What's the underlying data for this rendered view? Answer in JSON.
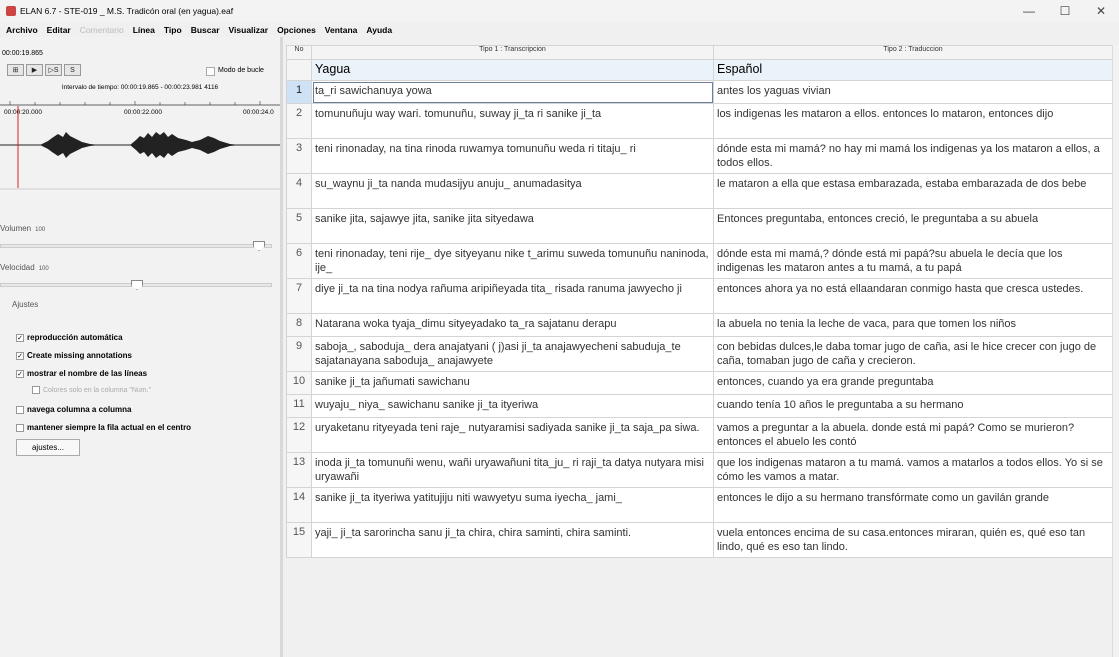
{
  "window": {
    "title": "ELAN 6.7 - STE-019 _ M.S. Tradicón oral (en yagua).eaf",
    "controls": {
      "minimize": "—",
      "maximize": "☐",
      "close": "✕"
    }
  },
  "menu": {
    "items": [
      {
        "label": "Archivo",
        "enabled": true
      },
      {
        "label": "Editar",
        "enabled": true
      },
      {
        "label": "Comentario",
        "enabled": false
      },
      {
        "label": "Línea",
        "enabled": true
      },
      {
        "label": "Tipo",
        "enabled": true
      },
      {
        "label": "Buscar",
        "enabled": true
      },
      {
        "label": "Visualizar",
        "enabled": true
      },
      {
        "label": "Opciones",
        "enabled": true
      },
      {
        "label": "Ventana",
        "enabled": true
      },
      {
        "label": "Ayuda",
        "enabled": true
      }
    ]
  },
  "player": {
    "timecode": "00:00:19.865",
    "buttons": [
      "⊞",
      "▶",
      "▷S",
      "S"
    ],
    "loop_label": "Modo de bucle",
    "interval_label": "Intervalo de tiempo: 00:00:19.865 - 00:00:23.981  4116",
    "ticks": [
      "00:00:20.000",
      "00:00:22.000",
      "00:00:24.0"
    ]
  },
  "volume": {
    "label": "Volumen",
    "value": "100",
    "level": 0.97
  },
  "speed": {
    "label": "Velocidad",
    "value": "100",
    "level": 0.5
  },
  "settings": {
    "title": "Ajustes",
    "options": [
      {
        "label": "reproducción automática",
        "checked": true,
        "bold": true
      },
      {
        "label": "Create missing annotations",
        "checked": true,
        "bold": true
      },
      {
        "label": "mostrar el nombre de las líneas",
        "checked": true,
        "bold": true
      },
      {
        "label": "Colores solo en la columna \"Num.\"",
        "checked": false,
        "bold": false,
        "disabled": true
      },
      {
        "label": "navega columna a columna",
        "checked": false,
        "bold": true
      },
      {
        "label": "mantener siempre la fila actual en el centro",
        "checked": false,
        "bold": true
      }
    ],
    "button_label": "ajustes..."
  },
  "grid": {
    "headers": {
      "num": "No",
      "col1": "Tipo 1 : Transcripcion",
      "col2": "Tipo 2 : Traduccion"
    },
    "language_row": {
      "col1": "Yagua",
      "col2": "Español"
    },
    "rows": [
      {
        "n": "1",
        "yagua": "ta_ri sawichanuya yowa",
        "espanol": "antes los yaguas vivian"
      },
      {
        "n": "2",
        "yagua": "tomunuñuju way wari. tomunuñu, suway ji_ta ri sanike ji_ta",
        "espanol": "los indigenas les mataron a ellos. entonces lo mataron, entonces dijo"
      },
      {
        "n": "3",
        "yagua": "teni rinonaday, na tina rinoda ruwamya tomunuñu weda ri titaju_ ri",
        "espanol": "dónde esta mi mamá? no hay mi mamá los indigenas ya los mataron a ellos, a todos ellos."
      },
      {
        "n": "4",
        "yagua": "su_waynu ji_ta nanda mudasijyu anuju_ anumadasitya",
        "espanol": "le mataron a ella que estasa embarazada, estaba embarazada de dos bebe"
      },
      {
        "n": "5",
        "yagua": "sanike jita, sajawye jita, sanike jita sityedawa",
        "espanol": "Entonces preguntaba, entonces creció, le preguntaba a su abuela"
      },
      {
        "n": "6",
        "yagua": "teni rinonaday, teni rije_ dye sityeyanu nike t_arimu suweda tomunuñu naninoda, ije_",
        "espanol": "dónde esta mi mamá,? dónde está mi papá?su abuela le decía que los indigenas les mataron antes a tu mamá, a tu papá"
      },
      {
        "n": "7",
        "yagua": "diye ji_ta na tina nodya rañuma aripiñeyada tita_ risada ranuma jawyecho ji",
        "espanol": "entonces ahora ya no está ellaandaran conmigo hasta que cresca ustedes."
      },
      {
        "n": "8",
        "yagua": "Natarana woka tyaja_dimu sityeyadako ta_ra sajatanu derapu",
        "espanol": "la abuela no tenia la leche de vaca, para que tomen los niños"
      },
      {
        "n": "9",
        "yagua": "saboja_, saboduja_ dera anajatyani ( j)asi ji_ta anajawyecheni sabuduja_te sajatanayana saboduja_ anajawyete",
        "espanol": "con bebidas dulces,le daba tomar  jugo de caña, asi le hice crecer con jugo de caña, tomaban jugo de caña y crecieron."
      },
      {
        "n": "10",
        "yagua": "sanike ji_ta jañumati sawichanu",
        "espanol": "entonces, cuando ya era grande preguntaba"
      },
      {
        "n": "11",
        "yagua": "wuyaju_ niya_ sawichanu sanike ji_ta ityeriwa",
        "espanol": "cuando tenía 10 años le preguntaba a su hermano"
      },
      {
        "n": "12",
        "yagua": "uryaketanu rityeyada teni raje_ nutyaramisi sadiyada sanike ji_ta saja_pa siwa.",
        "espanol": "vamos a preguntar a la abuela. donde está mi papá? Como se murieron? entonces el abuelo les contó"
      },
      {
        "n": "13",
        "yagua": "inoda ji_ta tomunuñi wenu, wañi uryawañuni tita_ju_ ri raji_ta datya nutyara misi uryawañi",
        "espanol": "que los indigenas mataron a tu mamá. vamos a matarlos a todos ellos. Yo si se cómo les vamos a matar."
      },
      {
        "n": "14",
        "yagua": "sanike ji_ta ityeriwa yatitujiju niti wawyetyu suma iyecha_ jami_",
        "espanol": "entonces le dijo a su hermano transfórmate como un gavilán grande"
      },
      {
        "n": "15",
        "yagua": "yaji_ ji_ta sarorincha sanu ji_ta chira, chira saminti, chira saminti.",
        "espanol": "vuela entonces encima de su casa.entonces miraran, quién es, qué eso tan lindo, qué es eso tan lindo."
      }
    ]
  }
}
